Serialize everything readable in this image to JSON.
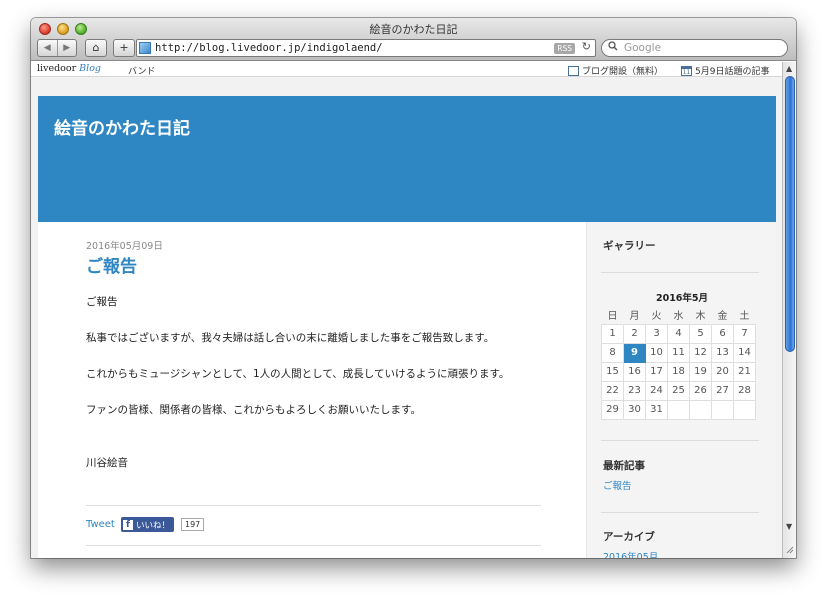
{
  "window": {
    "title": "絵音のかわた日記"
  },
  "toolbar": {
    "back_glyph": "◀",
    "forward_glyph": "▶",
    "home_glyph": "⌂",
    "add_glyph": "+",
    "url": "http://blog.livedoor.jp/indigolaend/",
    "rss": "RSS",
    "reload_glyph": "↻",
    "search_glyph": "🔍",
    "search_placeholder": "Google"
  },
  "topbar": {
    "logo_text": "livedoor",
    "logo_blog": "Blog",
    "band_link": "バンド",
    "open_blog": "ブログ開設（無料）",
    "calendar_icon_text": "11",
    "topic_link": "5月9日話題の記事"
  },
  "header": {
    "blog_title": "絵音のかわた日記"
  },
  "post": {
    "date": "2016年05月09日",
    "title": "ご報告",
    "paragraphs": [
      "ご報告",
      "私事ではございますが、我々夫婦は話し合いの末に離婚しました事をご報告致します。",
      "これからもミュージシャンとして、1人の人間として、成長していけるように頑張ります。",
      "ファンの皆様、関係者の皆様、これからもよろしくお願いいたします。",
      "川谷絵音"
    ],
    "tweet": "Tweet",
    "fb_icon": "f",
    "fb_like": "いいね！",
    "fb_count": "197"
  },
  "sidebar": {
    "gallery": "ギャラリー",
    "calendar": {
      "title": "2016年5月",
      "weekdays": [
        "日",
        "月",
        "火",
        "水",
        "木",
        "金",
        "土"
      ],
      "rows": [
        [
          "1",
          "2",
          "3",
          "4",
          "5",
          "6",
          "7"
        ],
        [
          "8",
          "9",
          "10",
          "11",
          "12",
          "13",
          "14"
        ],
        [
          "15",
          "16",
          "17",
          "18",
          "19",
          "20",
          "21"
        ],
        [
          "22",
          "23",
          "24",
          "25",
          "26",
          "27",
          "28"
        ],
        [
          "29",
          "30",
          "31",
          "",
          "",
          "",
          ""
        ]
      ],
      "today": "9"
    },
    "recent_heading": "最新記事",
    "recent_items": [
      "ご報告"
    ],
    "archive_heading": "アーカイブ",
    "archive_items": [
      "2016年05月"
    ]
  },
  "scrollbar": {
    "up_glyph": "▲",
    "down_glyph": "▼"
  }
}
